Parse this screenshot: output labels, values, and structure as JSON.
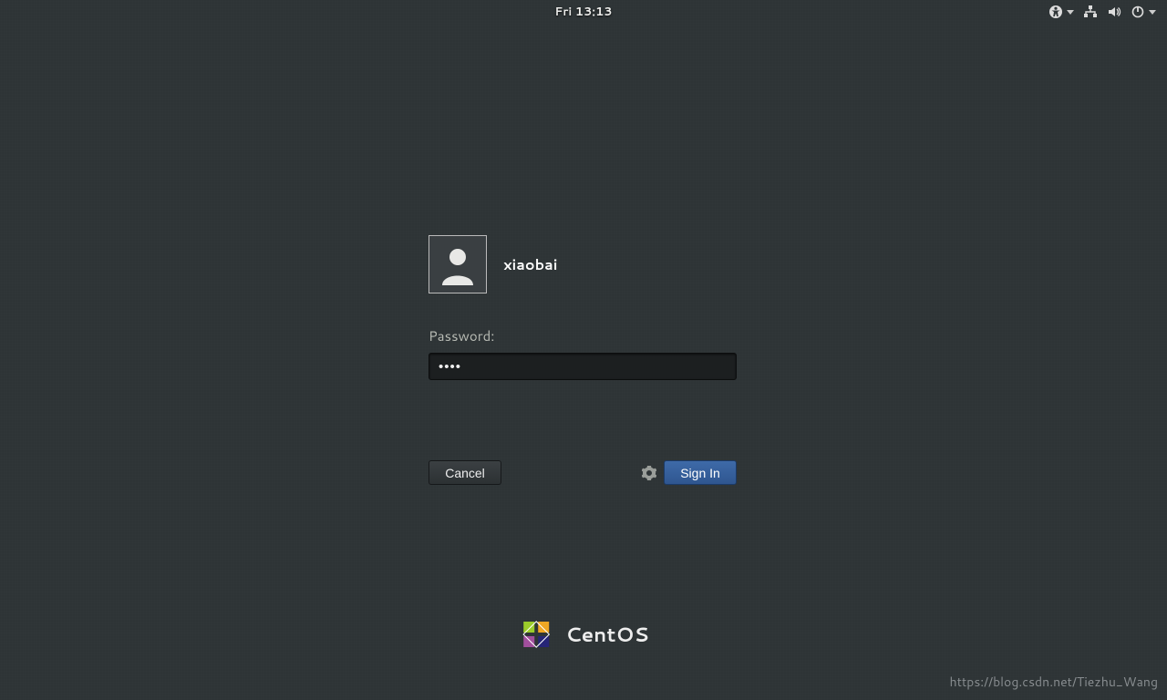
{
  "topbar": {
    "clock": "Fri 13:13"
  },
  "login": {
    "username": "xiaobai",
    "password_label": "Password:",
    "password_value": "••••",
    "cancel_label": "Cancel",
    "signin_label": "Sign In"
  },
  "brand": {
    "name": "CentOS"
  },
  "watermark": "https://blog.csdn.net/Tiezhu_Wang"
}
